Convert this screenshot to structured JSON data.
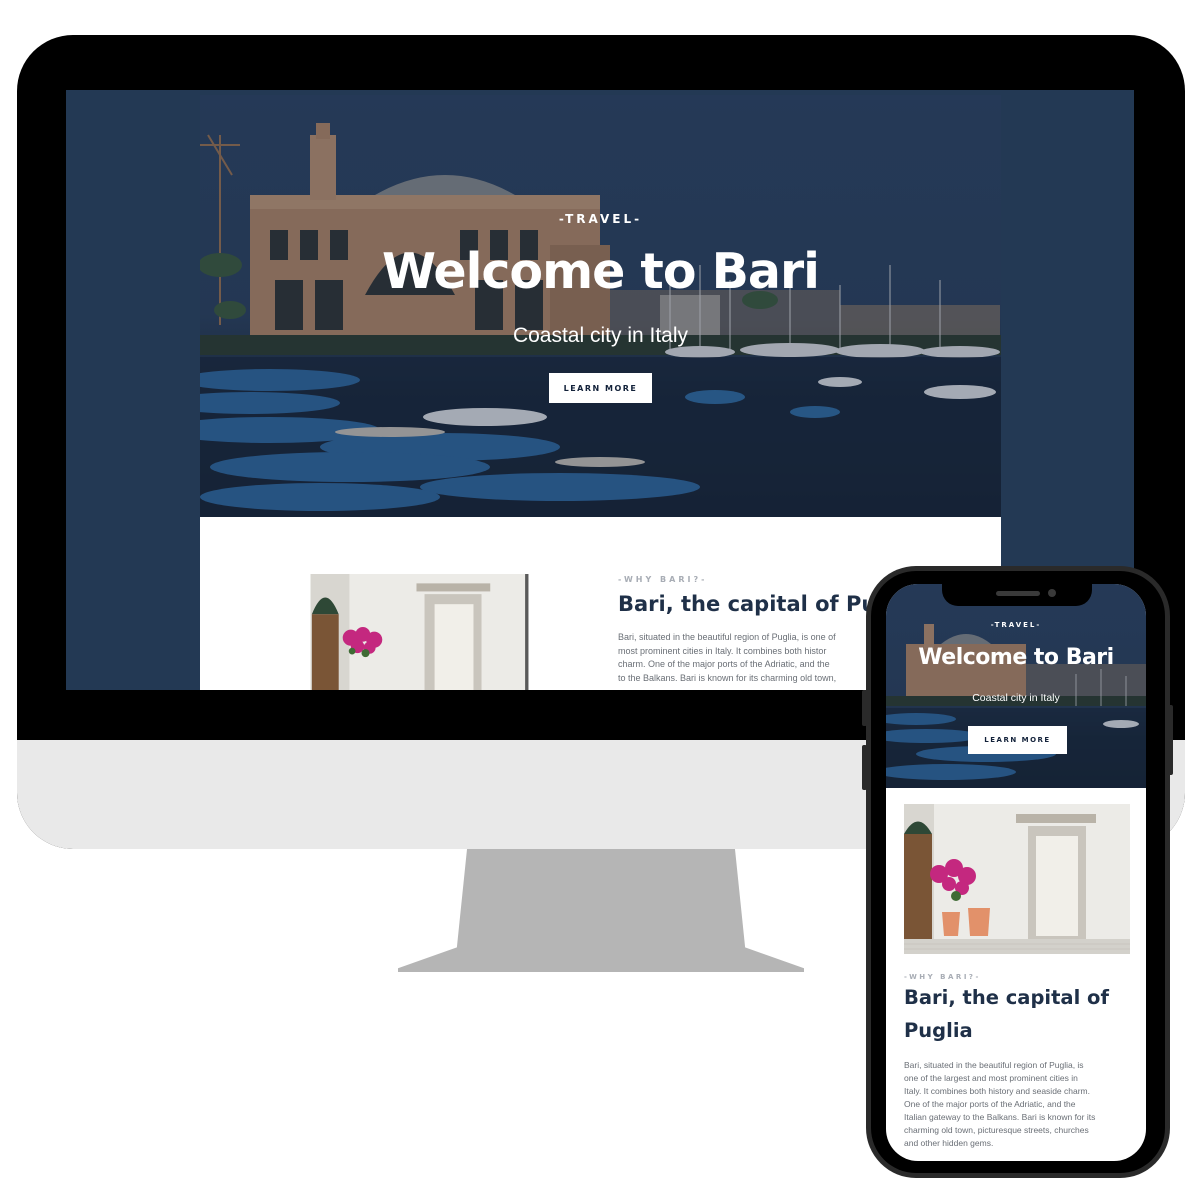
{
  "colors": {
    "navy": "#233954",
    "ink": "#1f3048",
    "muted": "#a8adb5",
    "text": "#6a6f76",
    "white": "#ffffff"
  },
  "desktop": {
    "hero": {
      "eyebrow": "-TRAVEL-",
      "title": "Welcome to Bari",
      "subtitle": "Coastal city in Italy",
      "cta": "LEARN MORE"
    },
    "about": {
      "eyebrow": "-WHY BARI?-",
      "title": "Bari, the capital of Pu",
      "lines": [
        "Bari, situated in the beautiful region of Puglia, is one of",
        "most prominent cities in Italy. It combines both histor",
        "charm. One of the major ports of the Adriatic, and the",
        "to the Balkans. Bari is known for its charming old town,"
      ]
    }
  },
  "phone": {
    "hero": {
      "eyebrow": "-TRAVEL-",
      "title": "Welcome to Bari",
      "subtitle": "Coastal city in Italy",
      "cta": "LEARN MORE"
    },
    "about": {
      "eyebrow": "-WHY BARI?-",
      "title_line1": "Bari, the capital of",
      "title_line2": "Puglia",
      "lines": [
        "Bari, situated in the beautiful region of Puglia, is",
        "one of the largest and most prominent cities in",
        "Italy. It combines both history and seaside charm.",
        "One of the major ports of the Adriatic, and the",
        "Italian gateway to the Balkans. Bari is known for its",
        "charming old town, picturesque streets, churches",
        "and other hidden gems."
      ]
    }
  },
  "icons": {
    "hero_photo": "harbor-photo-icon",
    "street_photo": "street-door-photo-icon"
  }
}
